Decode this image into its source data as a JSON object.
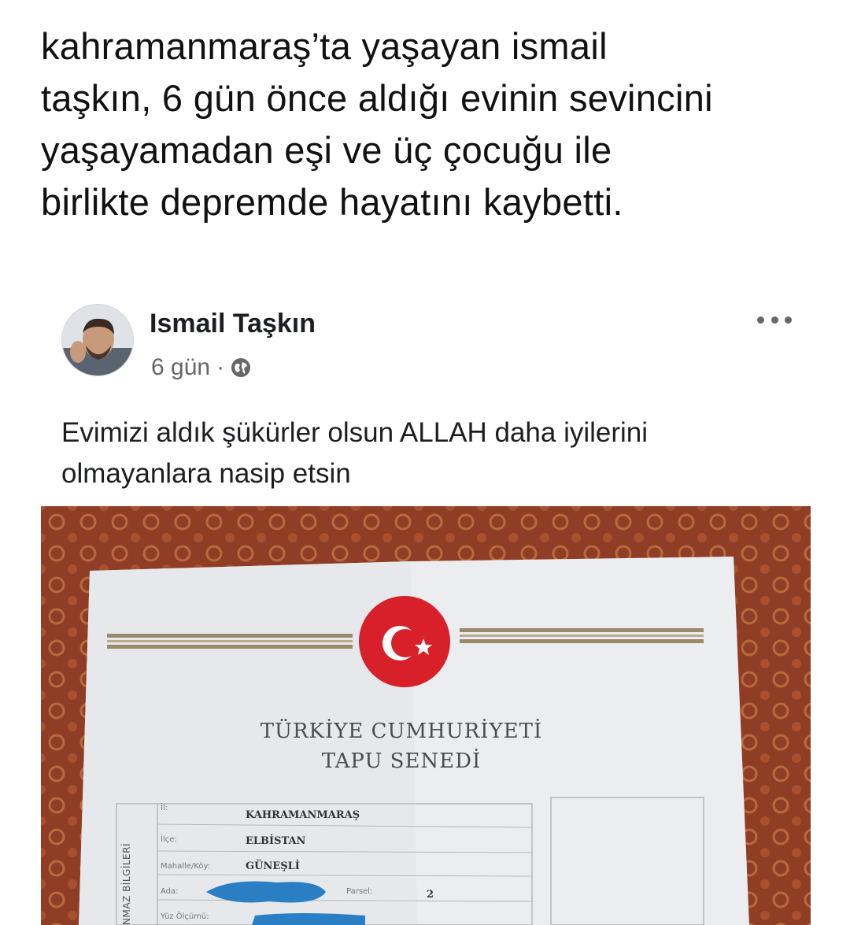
{
  "headline": {
    "lines": [
      "kahramanmaraş’ta yaşayan ismail",
      "taşkın, 6 gün önce aldığı evinin sevincini",
      "yaşayamadan eşi ve üç çocuğu ile",
      "birlikte depremde hayatını kaybetti."
    ]
  },
  "post": {
    "author": "Ismail Taşkın",
    "time": "6 gün",
    "separator": "·",
    "text_lines": [
      "Evimizi aldık şükürler olsun ALLAH daha iyilerini",
      "olmayanlara nasip etsin"
    ]
  },
  "deed": {
    "title_line1": "TÜRKİYE CUMHURİYETİ",
    "title_line2": "TAPU SENEDİ",
    "side_label": "NMAZ BİLGİLERİ",
    "rows": [
      {
        "label": "İl:",
        "value": "KAHRAMANMARAŞ"
      },
      {
        "label": "İlçe:",
        "value": "ELBİSTAN"
      },
      {
        "label": "Mahalle/Köy:",
        "value": "GÜNEŞLİ"
      },
      {
        "label": "Ada:",
        "value": ""
      },
      {
        "label": "Yüz Ölçümü:",
        "value": ""
      }
    ],
    "parsel_label": "Parsel:",
    "parsel_value": "2"
  },
  "icons": {
    "globe": "globe-icon",
    "more": "more-options-icon"
  }
}
